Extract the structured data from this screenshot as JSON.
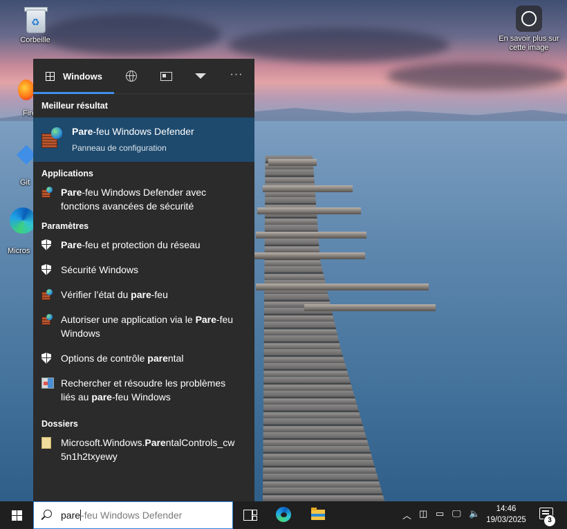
{
  "desktop": {
    "recycle_bin_label": "Corbeille",
    "learn_more_label": "En savoir plus sur cette image",
    "partial_labels": {
      "firefox": "Fire",
      "git": "Git",
      "edge": "Micros"
    }
  },
  "search_panel": {
    "tabs": {
      "windows_label": "Windows",
      "icons": [
        "grid-icon",
        "globe-icon",
        "news-icon",
        "chevron-down-icon",
        "more-icon"
      ]
    },
    "best_match": {
      "heading": "Meilleur résultat",
      "title_bold": "Pare",
      "title_rest": "-feu Windows Defender",
      "subtitle": "Panneau de configuration",
      "icon": "firewall-icon"
    },
    "applications": {
      "heading": "Applications",
      "items": [
        {
          "bold": "Pare",
          "rest": "-feu Windows Defender avec\nfonctions avancées de sécurité",
          "icon": "firewall-icon"
        }
      ]
    },
    "settings": {
      "heading": "Paramètres",
      "items": [
        {
          "pre": "",
          "bold": "Pare",
          "post": "-feu et protection du réseau",
          "icon": "shield-icon"
        },
        {
          "pre": "Sécurité Windows",
          "bold": "",
          "post": "",
          "icon": "shield-icon"
        },
        {
          "pre": "Vérifier l’état du ",
          "bold": "pare",
          "post": "-feu",
          "icon": "firewall-icon"
        },
        {
          "pre": "Autoriser une application via le ",
          "bold": "Pare",
          "post": "-feu\nWindows",
          "icon": "firewall-icon"
        },
        {
          "pre": "Options de contrôle ",
          "bold": "pare",
          "post": "ntal",
          "icon": "shield-icon"
        },
        {
          "pre": "Rechercher et résoudre les problèmes\nliés au ",
          "bold": "pare",
          "post": "-feu Windows",
          "icon": "troubleshoot-icon"
        }
      ]
    },
    "folders": {
      "heading": "Dossiers",
      "items": [
        {
          "pre": "Microsoft.Windows.",
          "bold": "Pare",
          "post": "ntalControls_cw\n5n1h2txyewy",
          "icon": "folder-icon"
        }
      ]
    }
  },
  "taskbar": {
    "search_typed": "pare",
    "search_hint": "-feu Windows Defender",
    "time": "14:46",
    "date": "19/03/2025",
    "notification_count": "3",
    "tray_icons": [
      "chevron-up-icon",
      "meet-now-icon",
      "battery-icon",
      "network-icon",
      "volume-icon"
    ]
  },
  "colors": {
    "panel_bg": "#2b2b2b",
    "best_match_bg": "#1e4a6e",
    "accent": "#3f8ee8",
    "taskbar_bg": "#1f1f1f"
  }
}
